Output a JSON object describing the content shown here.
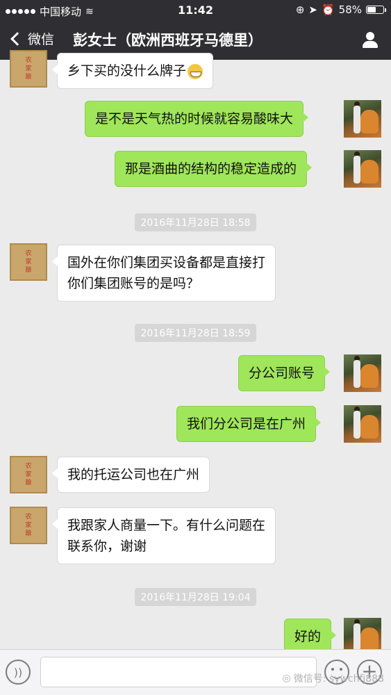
{
  "status_bar": {
    "carrier": "中国移动",
    "time": "11:42",
    "battery": "58%",
    "battery_level": 0.58
  },
  "nav": {
    "back_label": "微信",
    "title": "彭女士（欧洲西班牙马德里）"
  },
  "messages": [
    {
      "side": "in",
      "text": "乡下买的没什么牌子"
    },
    {
      "side": "out",
      "text": "是不是天气热的时候就容易酸味大"
    },
    {
      "side": "out",
      "text": "那是酒曲的结构的稳定造成的"
    },
    {
      "side": "in",
      "lines": [
        "国外在你们集团买设备都是直接打",
        "你们集团账号的是吗？"
      ]
    },
    {
      "side": "out",
      "text": "分公司账号"
    },
    {
      "side": "out",
      "text": "我们分公司是在广州"
    },
    {
      "side": "in",
      "text": "我的托运公司也在广州"
    },
    {
      "side": "in",
      "lines": [
        "我跟家人商量一下。有什么问题在",
        "联系你，谢谢"
      ]
    },
    {
      "side": "out",
      "text": "好的"
    }
  ],
  "timestamps": [
    "2016年11月28日 18:58",
    "2016年11月28日 18:59",
    "2016年11月28日 19:04"
  ],
  "avatar_stamp_text": [
    "农",
    "家",
    "酿"
  ],
  "watermark": "微信号: sywchfj888",
  "icons": {
    "back": "chevron-left-icon",
    "contact": "person-icon",
    "voice": "voice-icon",
    "emoji": "emoji-icon",
    "plus": "plus-icon"
  }
}
